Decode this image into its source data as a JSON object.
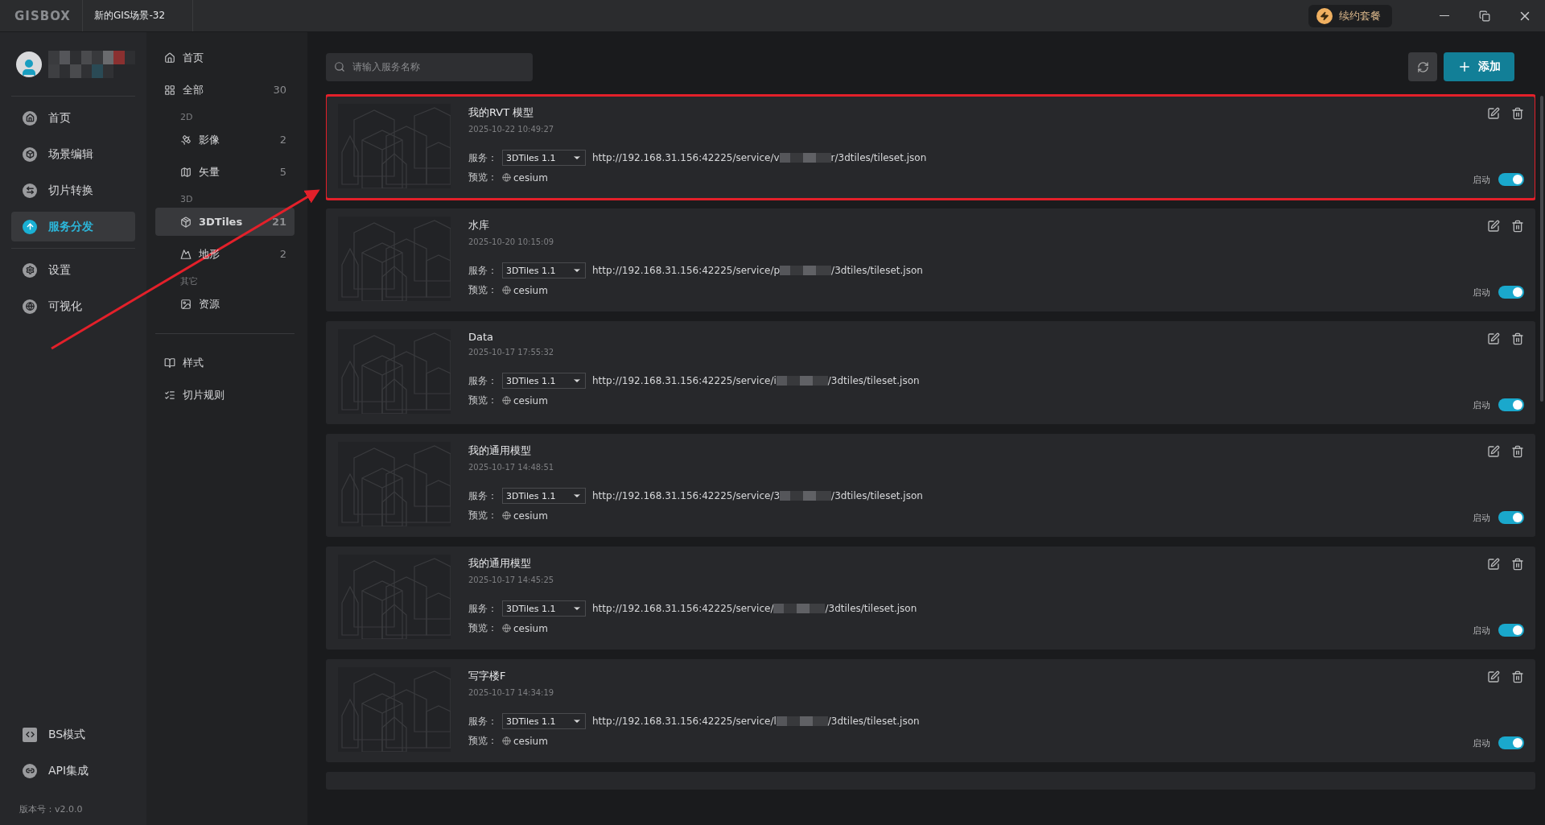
{
  "title_bar": {
    "logo": "GISBOX",
    "tab": "新的GIS场景-32",
    "renew_button": "续约套餐"
  },
  "nav": {
    "items": [
      {
        "label": "首页",
        "selected": false
      },
      {
        "label": "场景编辑",
        "selected": false
      },
      {
        "label": "切片转换",
        "selected": false
      },
      {
        "label": "服务分发",
        "selected": true
      }
    ],
    "items_2": [
      {
        "label": "设置",
        "selected": false
      },
      {
        "label": "可视化",
        "selected": false
      }
    ],
    "bottom_items": [
      {
        "label": "BS模式"
      },
      {
        "label": "API集成"
      }
    ],
    "version": "版本号：v2.0.0"
  },
  "categories": {
    "main": [
      {
        "kind": "item",
        "label": "首页",
        "selected": false
      },
      {
        "kind": "item",
        "label": "全部",
        "count": "30",
        "selected": false
      },
      {
        "kind": "heading",
        "label": "2D"
      },
      {
        "kind": "sub",
        "label": "影像",
        "count": "2",
        "selected": false
      },
      {
        "kind": "sub",
        "label": "矢量",
        "count": "5",
        "selected": false
      },
      {
        "kind": "heading",
        "label": "3D"
      },
      {
        "kind": "sub",
        "label": "3DTiles",
        "count": "21",
        "selected": true
      },
      {
        "kind": "sub",
        "label": "地形",
        "count": "2",
        "selected": false
      },
      {
        "kind": "heading",
        "label": "其它"
      },
      {
        "kind": "sub",
        "label": "资源",
        "selected": false
      }
    ],
    "extra": [
      {
        "kind": "item",
        "label": "样式",
        "selected": false
      },
      {
        "kind": "item",
        "label": "切片规则",
        "selected": false
      }
    ]
  },
  "search": {
    "placeholder": "请输入服务名称"
  },
  "add_button": "添加",
  "list": {
    "more_below": true,
    "cards": [
      {
        "title": "我的RVT 模型",
        "date": "2025-10-22 10:49:27",
        "service_label": "服务：",
        "service": "3DTiles 1.1",
        "url_start": "http://192.168.31.156:42225/service/v",
        "url_end": "r/3dtiles/tileset.json",
        "preview_label": "预览：",
        "preview": "cesium",
        "status_label": "启动",
        "on": true,
        "highlighted": true
      },
      {
        "title": "水库",
        "date": "2025-10-20 10:15:09",
        "service_label": "服务：",
        "service": "3DTiles 1.1",
        "url_start": "http://192.168.31.156:42225/service/p",
        "url_end": "/3dtiles/tileset.json",
        "preview_label": "预览：",
        "preview": "cesium",
        "status_label": "启动",
        "on": true,
        "highlighted": false
      },
      {
        "title": "Data",
        "date": "2025-10-17 17:55:32",
        "service_label": "服务：",
        "service": "3DTiles 1.1",
        "url_start": "http://192.168.31.156:42225/service/i",
        "url_end": "/3dtiles/tileset.json",
        "preview_label": "预览：",
        "preview": "cesium",
        "status_label": "启动",
        "on": true,
        "highlighted": false
      },
      {
        "title": "我的通用模型",
        "date": "2025-10-17 14:48:51",
        "service_label": "服务：",
        "service": "3DTiles 1.1",
        "url_start": "http://192.168.31.156:42225/service/3",
        "url_end": "/3dtiles/tileset.json",
        "preview_label": "预览：",
        "preview": "cesium",
        "status_label": "启动",
        "on": true,
        "highlighted": false
      },
      {
        "title": "我的通用模型",
        "date": "2025-10-17 14:45:25",
        "service_label": "服务：",
        "service": "3DTiles 1.1",
        "url_start": "http://192.168.31.156:42225/service/",
        "url_end": "/3dtiles/tileset.json",
        "preview_label": "预览：",
        "preview": "cesium",
        "status_label": "启动",
        "on": true,
        "highlighted": false
      },
      {
        "title": "写字楼F",
        "date": "2025-10-17 14:34:19",
        "service_label": "服务：",
        "service": "3DTiles 1.1",
        "url_start": "http://192.168.31.156:42225/service/l",
        "url_end": "/3dtiles/tileset.json",
        "preview_label": "预览：",
        "preview": "cesium",
        "status_label": "启动",
        "on": true,
        "highlighted": false
      }
    ]
  }
}
